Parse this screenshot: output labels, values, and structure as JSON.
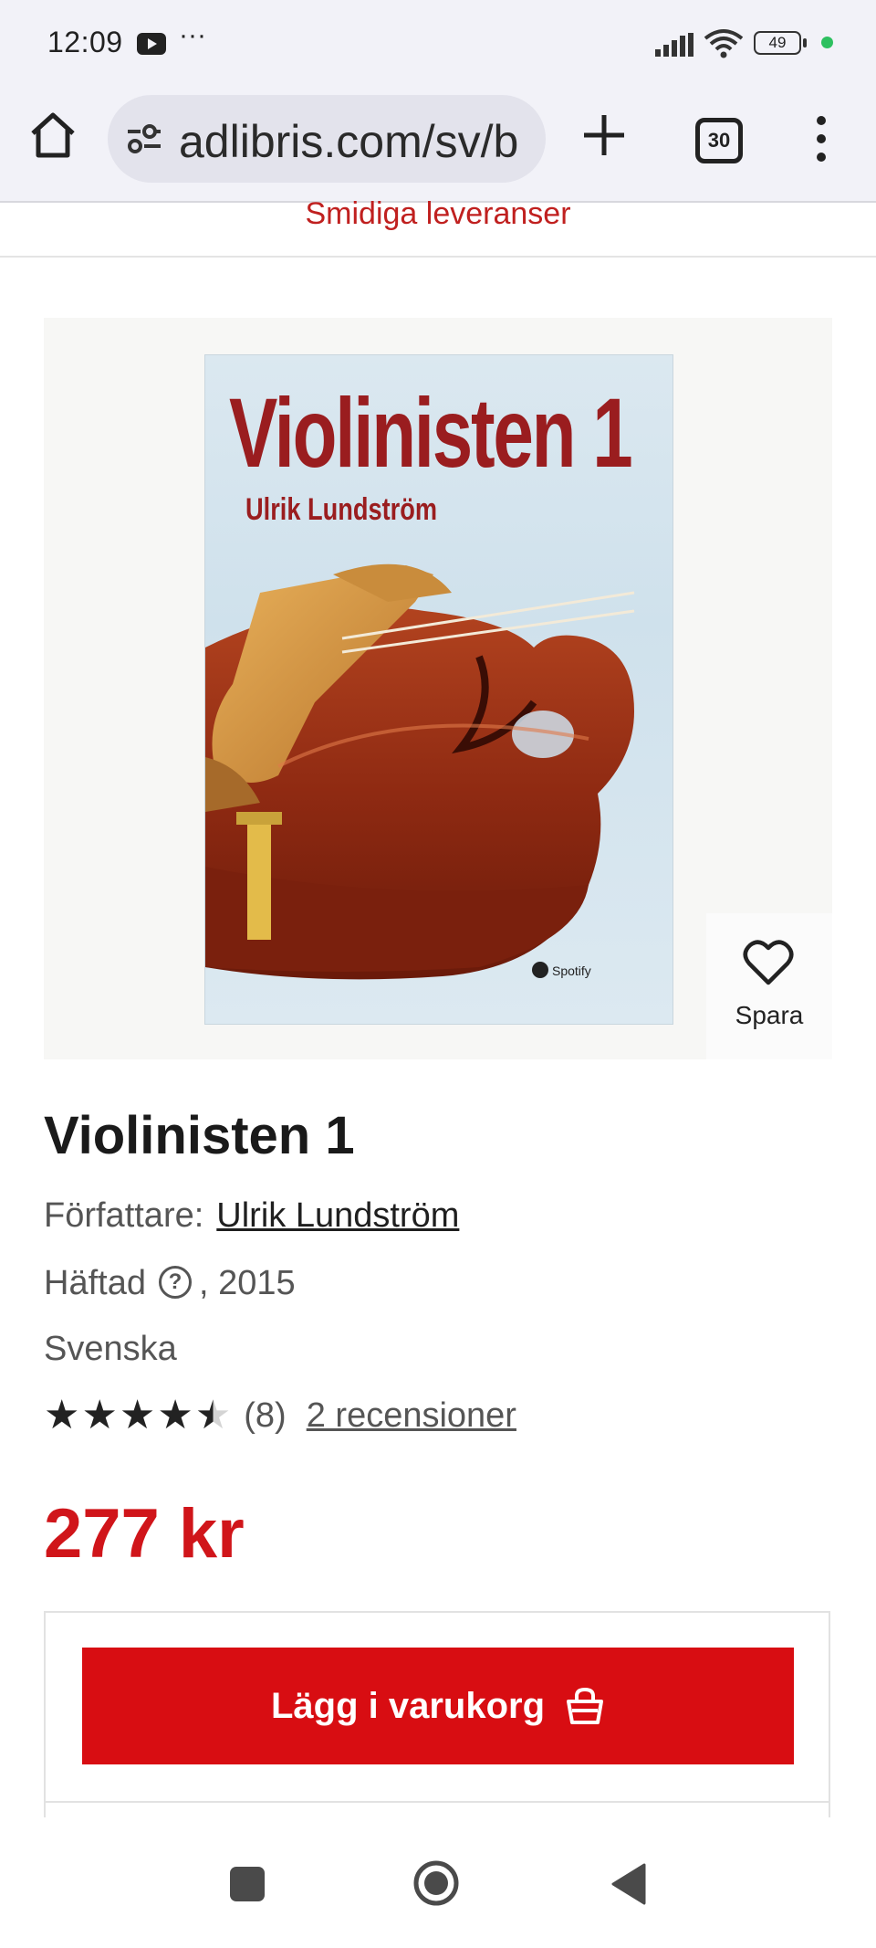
{
  "status_bar": {
    "time": "12:09",
    "dots": "···",
    "battery": "49",
    "accent_dot_color": "#2ec060"
  },
  "browser": {
    "url": "adlibris.com/sv/b",
    "tab_count": "30",
    "icons": [
      "home-icon",
      "site-settings-icon",
      "plus-icon",
      "tabs-icon",
      "more-vert-icon"
    ]
  },
  "banner": {
    "text": "Smidiga leveranser"
  },
  "product": {
    "cover": {
      "title": "Violinisten 1",
      "author": "Ulrik Lundström",
      "publisher": "Spotify"
    },
    "save_label": "Spara",
    "title": "Violinisten 1",
    "author_label": "Författare:",
    "author_name": "Ulrik Lundström",
    "format": "Häftad",
    "year": ", 2015",
    "language": "Svenska",
    "rating": 4.5,
    "rating_max": 5,
    "rating_count": "(8)",
    "reviews_link": "2 recensioner",
    "price": "277 kr",
    "price_color": "#d0151a",
    "add_to_cart": "Lägg i varukorg",
    "cart_button_color": "#d80d12"
  },
  "nav_bar": {
    "icons": [
      "recents-icon",
      "home-circle-icon",
      "back-icon"
    ]
  }
}
